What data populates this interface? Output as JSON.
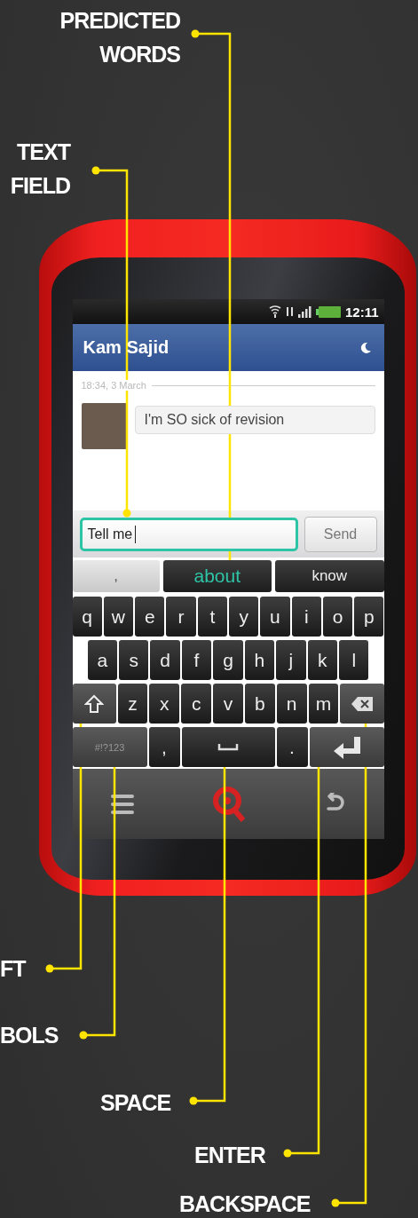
{
  "callouts": [
    {
      "label": "PREDICTED WORDS"
    },
    {
      "label": "TEXT FIELD"
    },
    {
      "label": "FT"
    },
    {
      "label": "BOLS"
    },
    {
      "label": "SPACE"
    },
    {
      "label": "ENTER"
    },
    {
      "label": "BACKSPACE"
    }
  ],
  "status_bar": {
    "time": "12:11"
  },
  "conversation": {
    "title": "Kam Sajid",
    "timestamp": "18:34, 3 March",
    "messages": [
      {
        "text": "I'm SO sick of revision"
      }
    ]
  },
  "compose": {
    "value": "Tell me",
    "send": "Send"
  },
  "suggestions": [
    {
      "word": ",",
      "selected": false
    },
    {
      "word": "about",
      "selected": true
    },
    {
      "word": "know",
      "selected": false
    }
  ],
  "keyboard": {
    "key_rows": [
      {
        "keys": [
          {
            "kind": "char",
            "label": "q"
          },
          {
            "kind": "char",
            "label": "w"
          },
          {
            "kind": "char",
            "label": "e"
          },
          {
            "kind": "char",
            "label": "r"
          },
          {
            "kind": "char",
            "label": "t"
          },
          {
            "kind": "char",
            "label": "y"
          },
          {
            "kind": "char",
            "label": "u"
          },
          {
            "kind": "char",
            "label": "i"
          },
          {
            "kind": "char",
            "label": "o"
          },
          {
            "kind": "char",
            "label": "p"
          }
        ]
      },
      {
        "keys": [
          {
            "kind": "char",
            "label": "a"
          },
          {
            "kind": "char",
            "label": "s"
          },
          {
            "kind": "char",
            "label": "d"
          },
          {
            "kind": "char",
            "label": "f"
          },
          {
            "kind": "char",
            "label": "g"
          },
          {
            "kind": "char",
            "label": "h"
          },
          {
            "kind": "char",
            "label": "j"
          },
          {
            "kind": "char",
            "label": "k"
          },
          {
            "kind": "char",
            "label": "l"
          }
        ]
      },
      {
        "keys": [
          {
            "kind": "shift"
          },
          {
            "kind": "char",
            "label": "z"
          },
          {
            "kind": "char",
            "label": "x"
          },
          {
            "kind": "char",
            "label": "c"
          },
          {
            "kind": "char",
            "label": "v"
          },
          {
            "kind": "char",
            "label": "b"
          },
          {
            "kind": "char",
            "label": "n"
          },
          {
            "kind": "char",
            "label": "m"
          },
          {
            "kind": "backspace"
          }
        ]
      },
      {
        "keys": [
          {
            "kind": "symbols",
            "label": "#!?123"
          },
          {
            "kind": "char",
            "label": ","
          },
          {
            "kind": "space"
          },
          {
            "kind": "char",
            "label": "."
          },
          {
            "kind": "enter"
          }
        ]
      }
    ]
  }
}
